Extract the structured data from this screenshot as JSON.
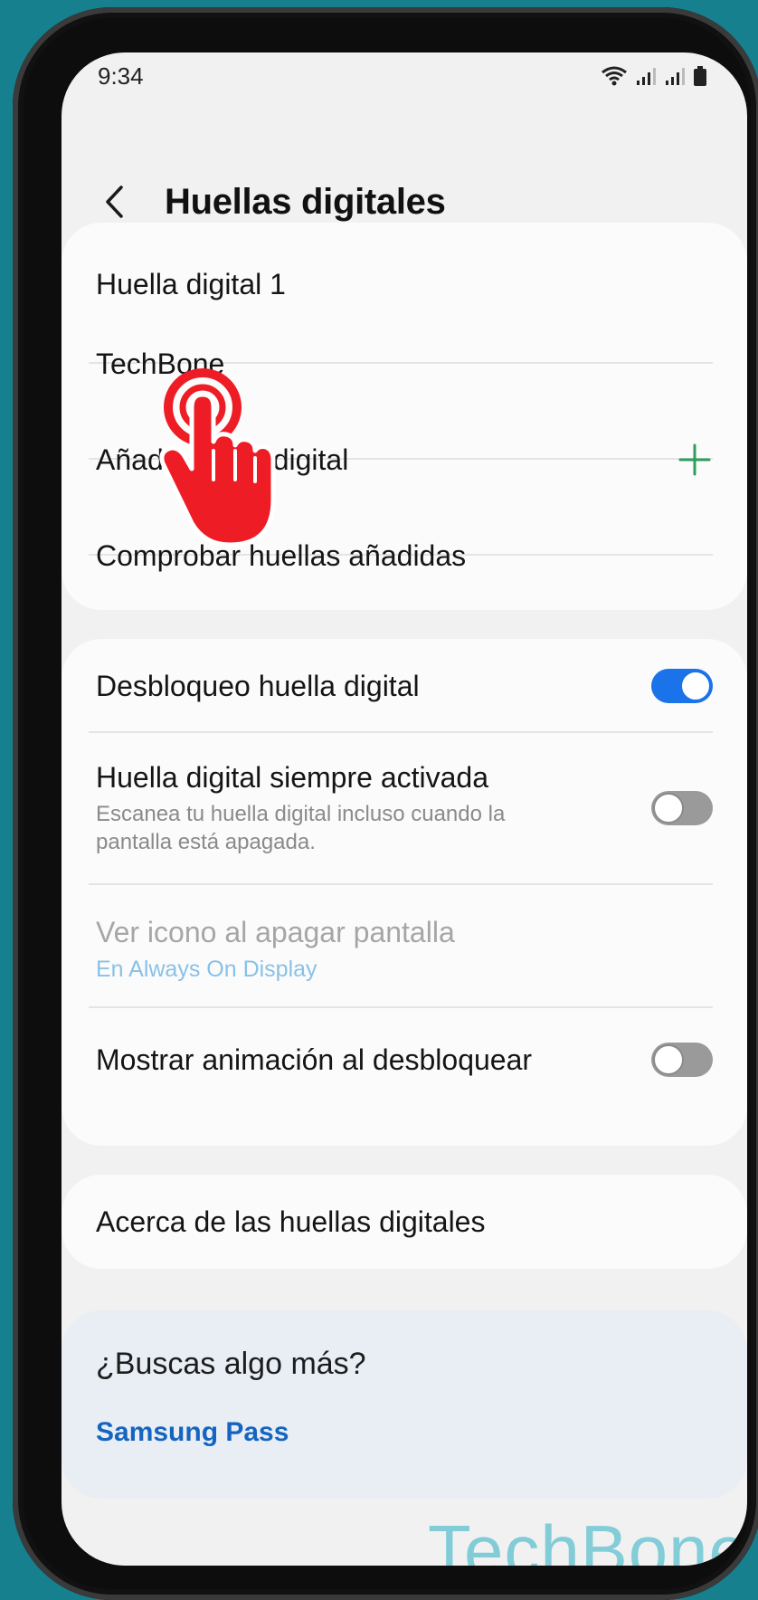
{
  "status_bar": {
    "time": "9:34",
    "icons": [
      "wifi-icon",
      "signal-icon",
      "signal-icon",
      "battery-icon"
    ]
  },
  "header": {
    "back_icon": "chevron-left-icon",
    "title": "Huellas digitales"
  },
  "fingerprints_card": {
    "items": [
      {
        "label": "Huella digital 1"
      },
      {
        "label": "TechBone"
      },
      {
        "label": "Añadir huella digital",
        "icon": "plus-icon"
      },
      {
        "label": "Comprobar huellas añadidas"
      }
    ]
  },
  "options_card": {
    "unlock": {
      "label": "Desbloqueo huella digital",
      "toggle_on": true
    },
    "always_on": {
      "label": "Huella digital siempre activada",
      "description": "Escanea tu huella digital incluso cuando la pantalla está apagada.",
      "toggle_on": false
    },
    "show_icon": {
      "label": "Ver icono al apagar pantalla",
      "sublabel": "En Always On Display",
      "disabled": true
    },
    "animation": {
      "label": "Mostrar animación al desbloquear",
      "toggle_on": false
    }
  },
  "about_card": {
    "label": "Acerca de las huellas digitales"
  },
  "suggestions": {
    "title": "¿Buscas algo más?",
    "link": "Samsung Pass"
  },
  "overlay": {
    "tap_indicator_icon": "tap-hand-icon",
    "watermark": "TechBone"
  },
  "colors": {
    "background": "#17808f",
    "toggle_on": "#1a73e8",
    "link": "#1565c0",
    "plus": "#2e9e5b",
    "tap_indicator": "#ee1c24"
  }
}
